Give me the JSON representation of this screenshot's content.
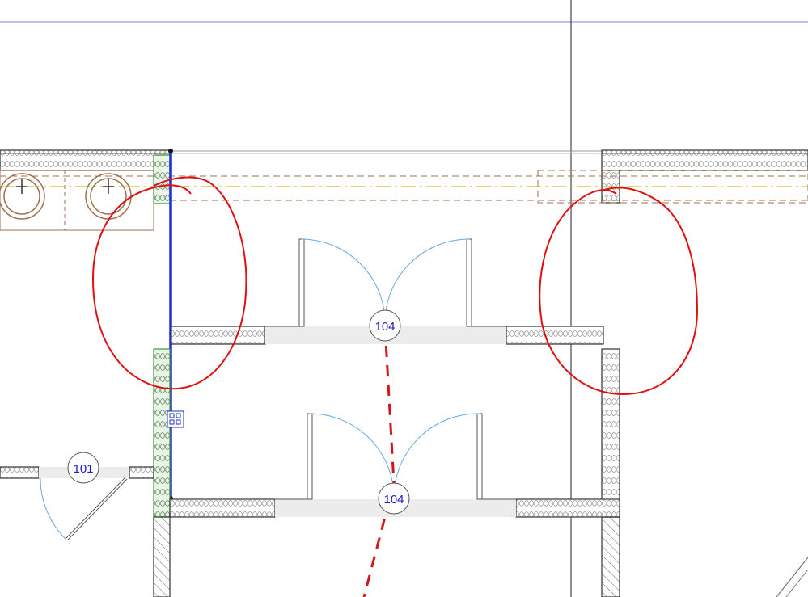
{
  "drawing": {
    "door_tags": [
      {
        "label": "104"
      },
      {
        "label": "104"
      },
      {
        "label": "101"
      }
    ],
    "colors": {
      "background": "#ffffff",
      "wall_outline": "#333333",
      "insulation": "#9a9a9a",
      "selected_wall": "#1f2fd6",
      "selected_fill": "#7fc97a",
      "markup_red": "#e01010",
      "door_swing": "#6aa8e0",
      "tag_text": "#1a1acc",
      "centerline": "#c8c020",
      "counter": "#a07050"
    },
    "icons": [
      "wall-hotspot-icon",
      "sink-icon"
    ]
  }
}
